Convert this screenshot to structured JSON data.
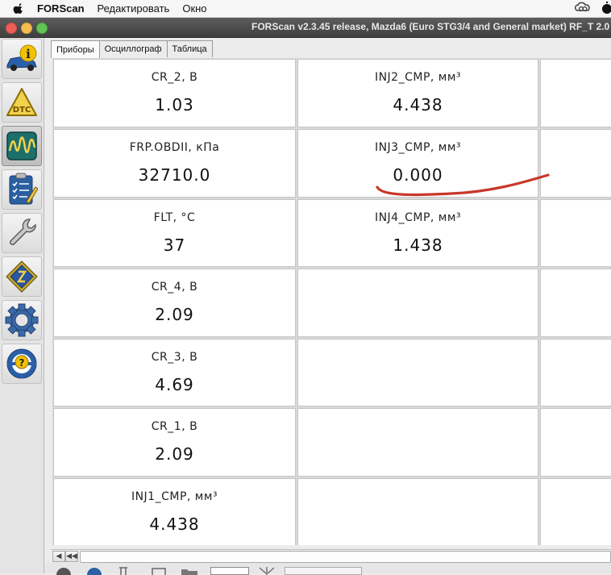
{
  "menubar": {
    "app_name": "FORScan",
    "items": [
      "Редактировать",
      "Окно"
    ]
  },
  "window": {
    "title": "FORScan v2.3.45 release, Mazda6 (Euro STG3/4 and General market) RF_T 2.0"
  },
  "sidebar": {
    "items": [
      {
        "icon": "car-info-icon",
        "active": false
      },
      {
        "icon": "dtc-warning-icon",
        "active": false
      },
      {
        "icon": "oscilloscope-wave-icon",
        "active": true
      },
      {
        "icon": "checklist-icon",
        "active": false
      },
      {
        "icon": "wrench-icon",
        "active": false
      },
      {
        "icon": "chip-icon",
        "active": false
      },
      {
        "icon": "gear-icon",
        "active": false
      },
      {
        "icon": "help-steering-wheel-icon",
        "active": false
      }
    ]
  },
  "tabs": [
    {
      "label": "Приборы",
      "active": true
    },
    {
      "label": "Осциллограф",
      "active": false
    },
    {
      "label": "Таблица",
      "active": false
    }
  ],
  "gauges": {
    "col1": [
      {
        "label": "CR_2, В",
        "value": "1.03"
      },
      {
        "label": "FRP.OBDII, кПа",
        "value": "32710.0"
      },
      {
        "label": "FLT, °C",
        "value": "37"
      },
      {
        "label": "CR_4, В",
        "value": "2.09"
      },
      {
        "label": "CR_3, В",
        "value": "4.69"
      },
      {
        "label": "CR_1, В",
        "value": "2.09"
      },
      {
        "label": "INJ1_CMP, мм³",
        "value": "4.438"
      }
    ],
    "col2": [
      {
        "label": "INJ2_CMP, мм³",
        "value": "4.438"
      },
      {
        "label": "INJ3_CMP, мм³",
        "value": "0.000"
      },
      {
        "label": "INJ4_CMP, мм³",
        "value": "1.438"
      }
    ]
  },
  "colors": {
    "annotation": "#c8372a",
    "title_bar": "#4a4a4a",
    "active_tab": "#fbfbfb"
  }
}
